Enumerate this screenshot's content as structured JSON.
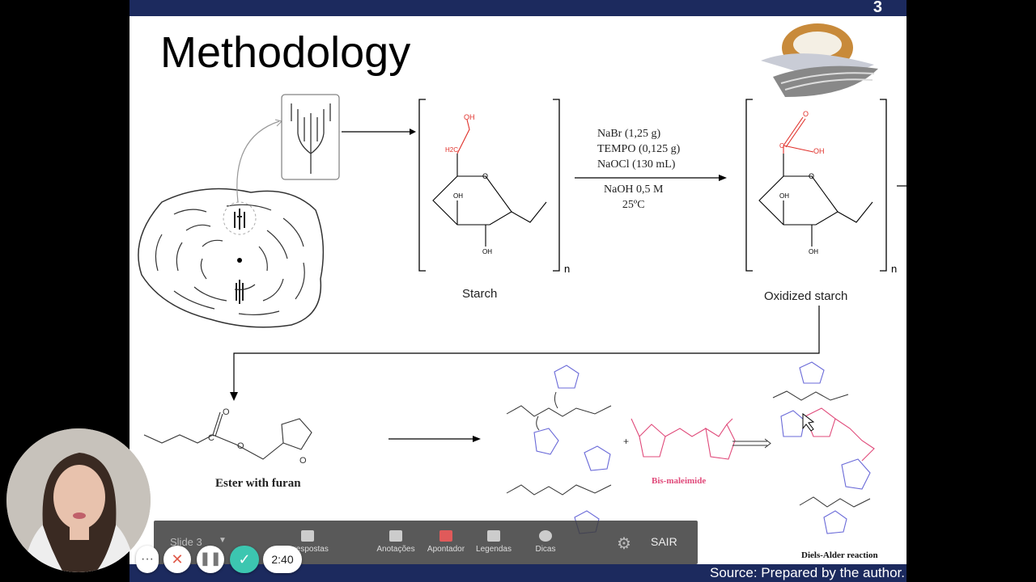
{
  "slide": {
    "title": "Methodology",
    "number": "3",
    "source": "Source: Prepared by the author."
  },
  "reaction": {
    "reagents": [
      "NaBr (1,25 g)",
      "TEMPO (0,125 g)",
      "NaOCl (130 mL)"
    ],
    "conditions": [
      "NaOH 0,5 M",
      "25ºC"
    ]
  },
  "labels": {
    "starch": "Starch",
    "oxidized_starch": "Oxidized starch",
    "ester": "Ester with furan",
    "bismaleimide": "Bis-maleimide",
    "diels_alder": "Diels-Alder reaction",
    "furan": "Furan",
    "n1": "n",
    "n2": "n"
  },
  "atoms": {
    "oh": "OH",
    "o": "O",
    "h2c": "H2C",
    "c": "C"
  },
  "toolbar": {
    "slide_select": "Slide 3",
    "qa": "e respostas",
    "annotations": "Anotações",
    "pointer": "Apontador",
    "captions": "Legendas",
    "tips": "Dicas",
    "exit": "SAIR"
  },
  "controls": {
    "timer": "2:40",
    "more": "···"
  },
  "colors": {
    "header_bar": "#1c2a5e",
    "red_atoms": "#e0302a",
    "furan_blue": "#6a6ad8",
    "bismaleimide_pink": "#e04a7a",
    "check_green": "#3cc6b0"
  }
}
